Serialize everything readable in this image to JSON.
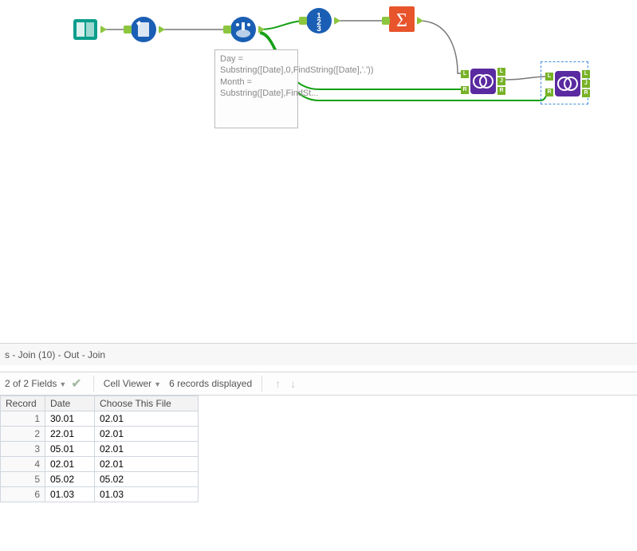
{
  "annotation": "Day = Substring([Date],0,FindString([Date],'.'))\nMonth = Substring([Date],FindSt...",
  "results_title": "s - Join (10) - Out - Join",
  "toolbar": {
    "fields_label": "2 of 2 Fields",
    "cell_viewer": "Cell Viewer",
    "records_label": "6 records displayed"
  },
  "table": {
    "headers": {
      "record": "Record",
      "date": "Date",
      "choose": "Choose This File"
    },
    "rows": [
      {
        "n": "1",
        "date": "30.01",
        "choose": "02.01"
      },
      {
        "n": "2",
        "date": "22.01",
        "choose": "02.01"
      },
      {
        "n": "3",
        "date": "05.01",
        "choose": "02.01"
      },
      {
        "n": "4",
        "date": "02.01",
        "choose": "02.01"
      },
      {
        "n": "5",
        "date": "05.02",
        "choose": "05.02"
      },
      {
        "n": "6",
        "date": "01.03",
        "choose": "01.03"
      }
    ]
  },
  "tools": {
    "input": "input-data-icon",
    "cleanse": "data-cleansing-icon",
    "formula": "formula-icon",
    "recordid": "record-id-icon",
    "summarize": "summarize-icon",
    "join1": "join-icon",
    "join2": "join-icon"
  }
}
